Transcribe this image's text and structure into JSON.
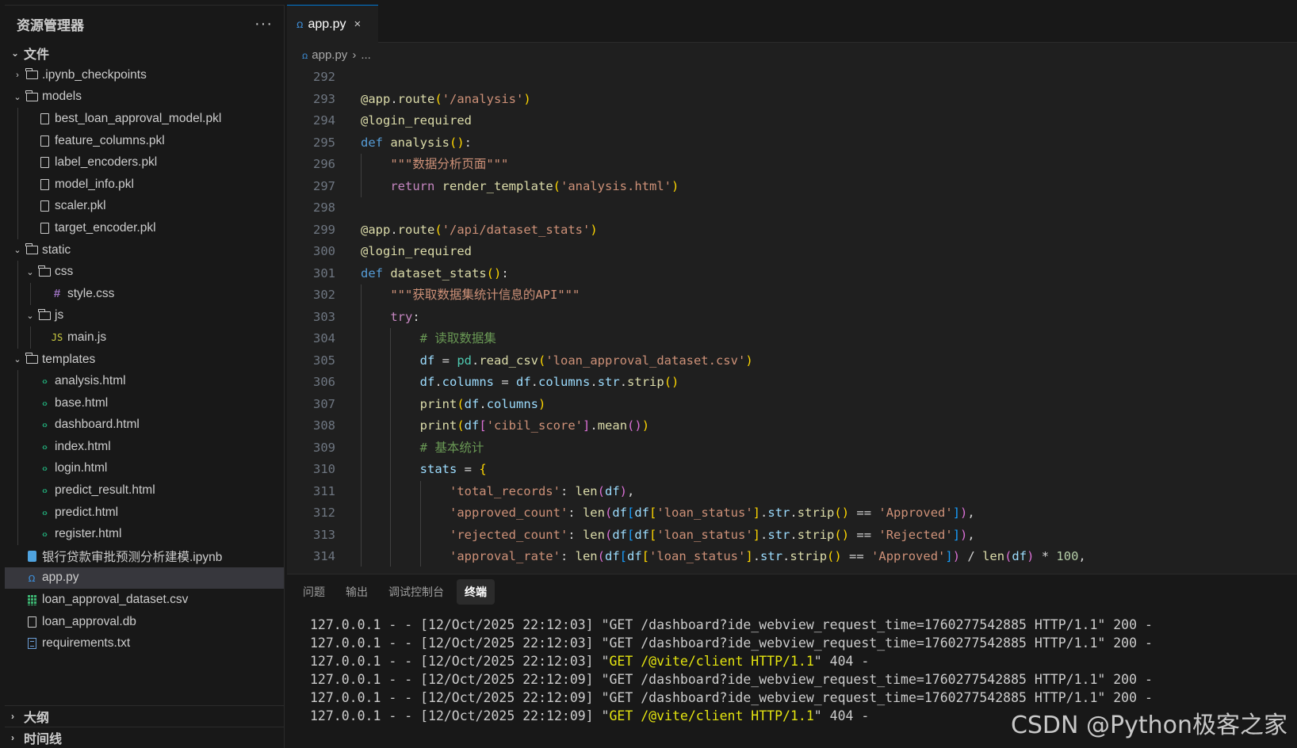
{
  "sidebar": {
    "title": "资源管理器",
    "more": "···",
    "section_files": "文件",
    "tree": [
      {
        "label": ".ipynb_checkpoints",
        "depth": 0,
        "kind": "folder",
        "expanded": false
      },
      {
        "label": "models",
        "depth": 0,
        "kind": "folder",
        "expanded": true
      },
      {
        "label": "best_loan_approval_model.pkl",
        "depth": 1,
        "kind": "file"
      },
      {
        "label": "feature_columns.pkl",
        "depth": 1,
        "kind": "file"
      },
      {
        "label": "label_encoders.pkl",
        "depth": 1,
        "kind": "file"
      },
      {
        "label": "model_info.pkl",
        "depth": 1,
        "kind": "file"
      },
      {
        "label": "scaler.pkl",
        "depth": 1,
        "kind": "file"
      },
      {
        "label": "target_encoder.pkl",
        "depth": 1,
        "kind": "file"
      },
      {
        "label": "static",
        "depth": 0,
        "kind": "folder",
        "expanded": true
      },
      {
        "label": "css",
        "depth": 1,
        "kind": "folder",
        "expanded": true
      },
      {
        "label": "style.css",
        "depth": 2,
        "kind": "css"
      },
      {
        "label": "js",
        "depth": 1,
        "kind": "folder",
        "expanded": true
      },
      {
        "label": "main.js",
        "depth": 2,
        "kind": "js"
      },
      {
        "label": "templates",
        "depth": 0,
        "kind": "folder",
        "expanded": true
      },
      {
        "label": "analysis.html",
        "depth": 1,
        "kind": "html"
      },
      {
        "label": "base.html",
        "depth": 1,
        "kind": "html"
      },
      {
        "label": "dashboard.html",
        "depth": 1,
        "kind": "html"
      },
      {
        "label": "index.html",
        "depth": 1,
        "kind": "html"
      },
      {
        "label": "login.html",
        "depth": 1,
        "kind": "html"
      },
      {
        "label": "predict_result.html",
        "depth": 1,
        "kind": "html"
      },
      {
        "label": "predict.html",
        "depth": 1,
        "kind": "html"
      },
      {
        "label": "register.html",
        "depth": 1,
        "kind": "html"
      },
      {
        "label": "银行贷款审批预测分析建模.ipynb",
        "depth": 0,
        "kind": "notebook"
      },
      {
        "label": "app.py",
        "depth": 0,
        "kind": "python",
        "selected": true
      },
      {
        "label": "loan_approval_dataset.csv",
        "depth": 0,
        "kind": "csv"
      },
      {
        "label": "loan_approval.db",
        "depth": 0,
        "kind": "file"
      },
      {
        "label": "requirements.txt",
        "depth": 0,
        "kind": "txt"
      }
    ],
    "section_outline": "大纲",
    "section_timeline": "时间线"
  },
  "editor": {
    "tab_label": "app.py",
    "tab_close": "×",
    "breadcrumb_file": "app.py",
    "breadcrumb_more": "...",
    "lines": [
      {
        "n": "292",
        "indent": 0,
        "tokens": []
      },
      {
        "n": "293",
        "indent": 0,
        "tokens": [
          [
            "dec",
            "@app"
          ],
          [
            "op",
            "."
          ],
          [
            "fn",
            "route"
          ],
          [
            "b1",
            "("
          ],
          [
            "str",
            "'/analysis'"
          ],
          [
            "b1",
            ")"
          ]
        ]
      },
      {
        "n": "294",
        "indent": 0,
        "tokens": [
          [
            "dec",
            "@login_required"
          ]
        ]
      },
      {
        "n": "295",
        "indent": 0,
        "tokens": [
          [
            "kw",
            "def"
          ],
          [
            "op",
            " "
          ],
          [
            "fn",
            "analysis"
          ],
          [
            "b1",
            "()"
          ],
          [
            "op",
            ":"
          ]
        ]
      },
      {
        "n": "296",
        "indent": 1,
        "tokens": [
          [
            "str",
            "\"\"\"数据分析页面\"\"\""
          ]
        ]
      },
      {
        "n": "297",
        "indent": 1,
        "tokens": [
          [
            "ctl",
            "return"
          ],
          [
            "op",
            " "
          ],
          [
            "fn",
            "render_template"
          ],
          [
            "b1",
            "("
          ],
          [
            "str",
            "'analysis.html'"
          ],
          [
            "b1",
            ")"
          ]
        ]
      },
      {
        "n": "298",
        "indent": 0,
        "tokens": []
      },
      {
        "n": "299",
        "indent": 0,
        "tokens": [
          [
            "dec",
            "@app"
          ],
          [
            "op",
            "."
          ],
          [
            "fn",
            "route"
          ],
          [
            "b1",
            "("
          ],
          [
            "str",
            "'/api/dataset_stats'"
          ],
          [
            "b1",
            ")"
          ]
        ]
      },
      {
        "n": "300",
        "indent": 0,
        "tokens": [
          [
            "dec",
            "@login_required"
          ]
        ]
      },
      {
        "n": "301",
        "indent": 0,
        "tokens": [
          [
            "kw",
            "def"
          ],
          [
            "op",
            " "
          ],
          [
            "fn",
            "dataset_stats"
          ],
          [
            "b1",
            "()"
          ],
          [
            "op",
            ":"
          ]
        ]
      },
      {
        "n": "302",
        "indent": 1,
        "tokens": [
          [
            "str",
            "\"\"\"获取数据集统计信息的API\"\"\""
          ]
        ]
      },
      {
        "n": "303",
        "indent": 1,
        "tokens": [
          [
            "ctl",
            "try"
          ],
          [
            "op",
            ":"
          ]
        ]
      },
      {
        "n": "304",
        "indent": 2,
        "tokens": [
          [
            "com",
            "# 读取数据集"
          ]
        ]
      },
      {
        "n": "305",
        "indent": 2,
        "tokens": [
          [
            "var",
            "df"
          ],
          [
            "op",
            " = "
          ],
          [
            "cls",
            "pd"
          ],
          [
            "op",
            "."
          ],
          [
            "fn",
            "read_csv"
          ],
          [
            "b1",
            "("
          ],
          [
            "str",
            "'loan_approval_dataset.csv'"
          ],
          [
            "b1",
            ")"
          ]
        ]
      },
      {
        "n": "306",
        "indent": 2,
        "tokens": [
          [
            "var",
            "df"
          ],
          [
            "op",
            "."
          ],
          [
            "var",
            "columns"
          ],
          [
            "op",
            " = "
          ],
          [
            "var",
            "df"
          ],
          [
            "op",
            "."
          ],
          [
            "var",
            "columns"
          ],
          [
            "op",
            "."
          ],
          [
            "var",
            "str"
          ],
          [
            "op",
            "."
          ],
          [
            "fn",
            "strip"
          ],
          [
            "b1",
            "()"
          ]
        ]
      },
      {
        "n": "307",
        "indent": 2,
        "tokens": [
          [
            "fn",
            "print"
          ],
          [
            "b1",
            "("
          ],
          [
            "var",
            "df"
          ],
          [
            "op",
            "."
          ],
          [
            "var",
            "columns"
          ],
          [
            "b1",
            ")"
          ]
        ]
      },
      {
        "n": "308",
        "indent": 2,
        "tokens": [
          [
            "fn",
            "print"
          ],
          [
            "b1",
            "("
          ],
          [
            "var",
            "df"
          ],
          [
            "b2",
            "["
          ],
          [
            "str",
            "'cibil_score'"
          ],
          [
            "b2",
            "]"
          ],
          [
            "op",
            "."
          ],
          [
            "fn",
            "mean"
          ],
          [
            "b2",
            "()"
          ],
          [
            "b1",
            ")"
          ]
        ]
      },
      {
        "n": "309",
        "indent": 2,
        "tokens": [
          [
            "com",
            "# 基本统计"
          ]
        ]
      },
      {
        "n": "310",
        "indent": 2,
        "tokens": [
          [
            "var",
            "stats"
          ],
          [
            "op",
            " = "
          ],
          [
            "b1",
            "{"
          ]
        ]
      },
      {
        "n": "311",
        "indent": 3,
        "tokens": [
          [
            "str",
            "'total_records'"
          ],
          [
            "op",
            ": "
          ],
          [
            "fn",
            "len"
          ],
          [
            "b2",
            "("
          ],
          [
            "var",
            "df"
          ],
          [
            "b2",
            ")"
          ],
          [
            "op",
            ","
          ]
        ]
      },
      {
        "n": "312",
        "indent": 3,
        "tokens": [
          [
            "str",
            "'approved_count'"
          ],
          [
            "op",
            ": "
          ],
          [
            "fn",
            "len"
          ],
          [
            "b2",
            "("
          ],
          [
            "var",
            "df"
          ],
          [
            "b3",
            "["
          ],
          [
            "var",
            "df"
          ],
          [
            "b1",
            "["
          ],
          [
            "str",
            "'loan_status'"
          ],
          [
            "b1",
            "]"
          ],
          [
            "op",
            "."
          ],
          [
            "var",
            "str"
          ],
          [
            "op",
            "."
          ],
          [
            "fn",
            "strip"
          ],
          [
            "b1",
            "()"
          ],
          [
            "op",
            " == "
          ],
          [
            "str",
            "'Approved'"
          ],
          [
            "b3",
            "]"
          ],
          [
            "b2",
            ")"
          ],
          [
            "op",
            ","
          ]
        ]
      },
      {
        "n": "313",
        "indent": 3,
        "tokens": [
          [
            "str",
            "'rejected_count'"
          ],
          [
            "op",
            ": "
          ],
          [
            "fn",
            "len"
          ],
          [
            "b2",
            "("
          ],
          [
            "var",
            "df"
          ],
          [
            "b3",
            "["
          ],
          [
            "var",
            "df"
          ],
          [
            "b1",
            "["
          ],
          [
            "str",
            "'loan_status'"
          ],
          [
            "b1",
            "]"
          ],
          [
            "op",
            "."
          ],
          [
            "var",
            "str"
          ],
          [
            "op",
            "."
          ],
          [
            "fn",
            "strip"
          ],
          [
            "b1",
            "()"
          ],
          [
            "op",
            " == "
          ],
          [
            "str",
            "'Rejected'"
          ],
          [
            "b3",
            "]"
          ],
          [
            "b2",
            ")"
          ],
          [
            "op",
            ","
          ]
        ]
      },
      {
        "n": "314",
        "indent": 3,
        "tokens": [
          [
            "str",
            "'approval_rate'"
          ],
          [
            "op",
            ": "
          ],
          [
            "fn",
            "len"
          ],
          [
            "b2",
            "("
          ],
          [
            "var",
            "df"
          ],
          [
            "b3",
            "["
          ],
          [
            "var",
            "df"
          ],
          [
            "b1",
            "["
          ],
          [
            "str",
            "'loan_status'"
          ],
          [
            "b1",
            "]"
          ],
          [
            "op",
            "."
          ],
          [
            "var",
            "str"
          ],
          [
            "op",
            "."
          ],
          [
            "fn",
            "strip"
          ],
          [
            "b1",
            "()"
          ],
          [
            "op",
            " == "
          ],
          [
            "str",
            "'Approved'"
          ],
          [
            "b3",
            "]"
          ],
          [
            "b2",
            ")"
          ],
          [
            "op",
            " / "
          ],
          [
            "fn",
            "len"
          ],
          [
            "b2",
            "("
          ],
          [
            "var",
            "df"
          ],
          [
            "b2",
            ")"
          ],
          [
            "op",
            " * "
          ],
          [
            "num",
            "100"
          ],
          [
            "op",
            ","
          ]
        ]
      }
    ]
  },
  "panel": {
    "tabs": [
      "问题",
      "输出",
      "调试控制台",
      "终端"
    ],
    "active_tab": "终端",
    "terminal": [
      {
        "plain": "127.0.0.1 - - [12/Oct/2025 22:12:03] \"GET /dashboard?ide_webview_request_time=1760277542885 HTTP/1.1\" 200 -",
        "hl": ""
      },
      {
        "plain": "127.0.0.1 - - [12/Oct/2025 22:12:03] \"GET /dashboard?ide_webview_request_time=1760277542885 HTTP/1.1\" 200 -",
        "hl": ""
      },
      {
        "pre": "127.0.0.1 - - [12/Oct/2025 22:12:03] \"",
        "hl": "GET /@vite/client HTTP/1.1",
        "post": "\" 404 -"
      },
      {
        "plain": "127.0.0.1 - - [12/Oct/2025 22:12:09] \"GET /dashboard?ide_webview_request_time=1760277542885 HTTP/1.1\" 200 -",
        "hl": ""
      },
      {
        "plain": "127.0.0.1 - - [12/Oct/2025 22:12:09] \"GET /dashboard?ide_webview_request_time=1760277542885 HTTP/1.1\" 200 -",
        "hl": ""
      },
      {
        "pre": "127.0.0.1 - - [12/Oct/2025 22:12:09] \"",
        "hl": "GET /@vite/client HTTP/1.1",
        "post": "\" 404 -"
      }
    ]
  },
  "watermark": "CSDN @Python极客之家"
}
